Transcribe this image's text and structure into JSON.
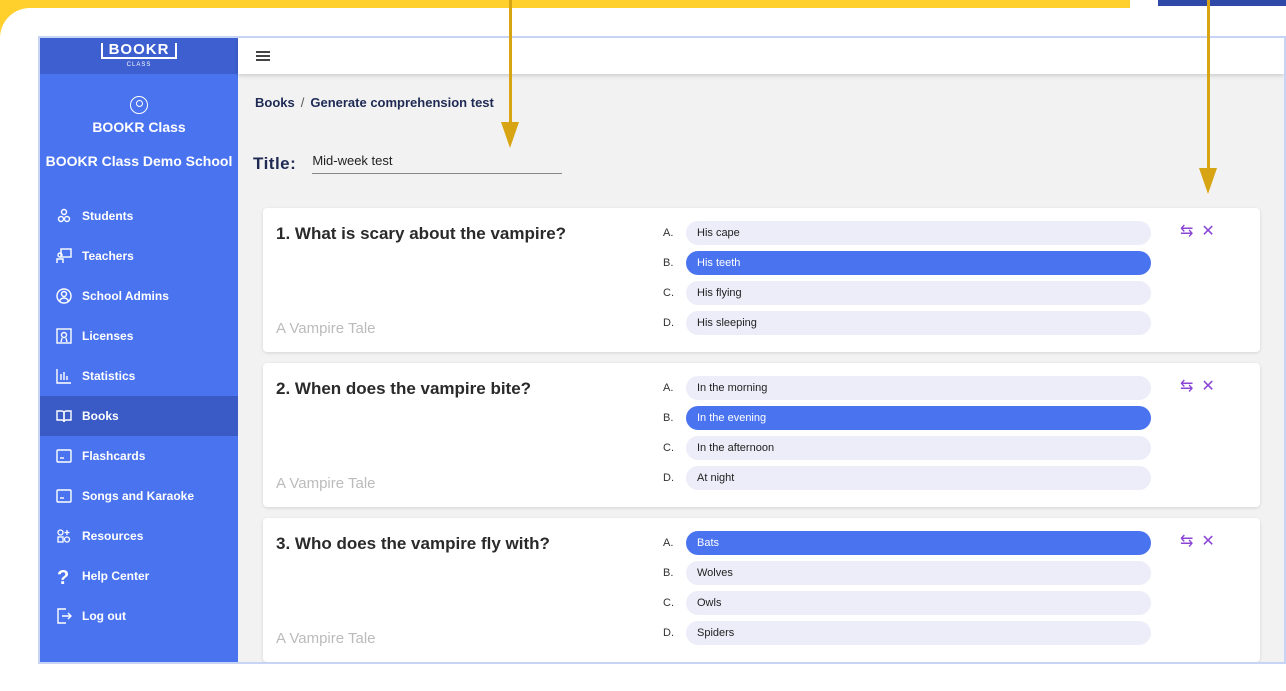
{
  "logo": {
    "name": "BOOKR",
    "sub": "CLASS"
  },
  "profile": {
    "name": "BOOKR Class",
    "school": "BOOKR Class Demo School"
  },
  "sidebar": {
    "items": [
      {
        "label": "Students",
        "icon": "students-icon"
      },
      {
        "label": "Teachers",
        "icon": "teachers-icon"
      },
      {
        "label": "School Admins",
        "icon": "school-admins-icon"
      },
      {
        "label": "Licenses",
        "icon": "licenses-icon"
      },
      {
        "label": "Statistics",
        "icon": "statistics-icon"
      },
      {
        "label": "Books",
        "icon": "book-icon",
        "active": true
      },
      {
        "label": "Flashcards",
        "icon": "flashcards-icon"
      },
      {
        "label": "Songs and Karaoke",
        "icon": "songs-icon"
      },
      {
        "label": "Resources",
        "icon": "resources-icon"
      },
      {
        "label": "Help Center",
        "icon": "help-icon"
      },
      {
        "label": "Log out",
        "icon": "logout-icon"
      }
    ]
  },
  "breadcrumb": {
    "root": "Books",
    "sep": "/",
    "current": "Generate comprehension test"
  },
  "title": {
    "label": "Title:",
    "value": "Mid-week test"
  },
  "questions": [
    {
      "text": "1. What is scary about the vampire?",
      "book": "A Vampire Tale",
      "options": [
        {
          "letter": "A.",
          "text": "His cape",
          "correct": false
        },
        {
          "letter": "B.",
          "text": "His teeth",
          "correct": true
        },
        {
          "letter": "C.",
          "text": "His flying",
          "correct": false
        },
        {
          "letter": "D.",
          "text": "His sleeping",
          "correct": false
        }
      ]
    },
    {
      "text": "2. When does the vampire bite?",
      "book": "A Vampire Tale",
      "options": [
        {
          "letter": "A.",
          "text": "In the morning",
          "correct": false
        },
        {
          "letter": "B.",
          "text": "In the evening",
          "correct": true
        },
        {
          "letter": "C.",
          "text": "In the afternoon",
          "correct": false
        },
        {
          "letter": "D.",
          "text": "At night",
          "correct": false
        }
      ]
    },
    {
      "text": "3. Who does the vampire fly with?",
      "book": "A Vampire Tale",
      "options": [
        {
          "letter": "A.",
          "text": "Bats",
          "correct": true
        },
        {
          "letter": "B.",
          "text": "Wolves",
          "correct": false
        },
        {
          "letter": "C.",
          "text": "Owls",
          "correct": false
        },
        {
          "letter": "D.",
          "text": "Spiders",
          "correct": false
        }
      ]
    }
  ],
  "colors": {
    "accent": "#4a73ef",
    "frame": "#ffcf2b",
    "action": "#8a45d6",
    "arrow": "#d7a413"
  }
}
